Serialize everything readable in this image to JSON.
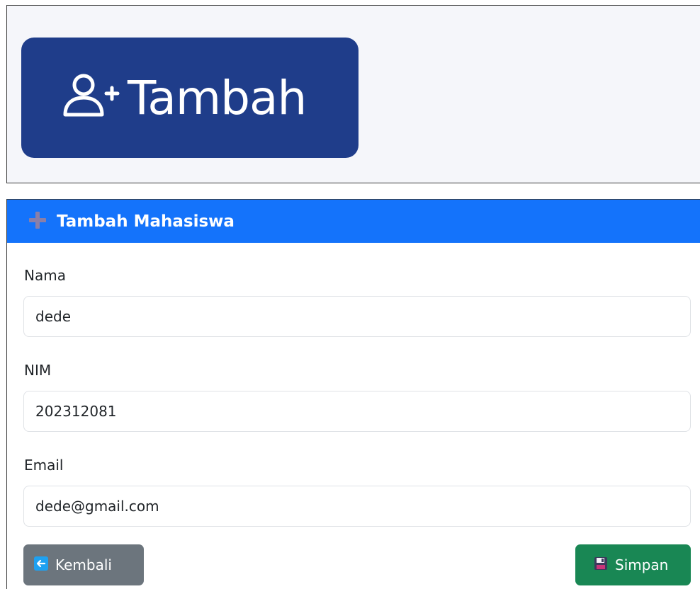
{
  "top_button": {
    "label": "Tambah",
    "icon": "user-plus-icon",
    "bg_color": "#1f3d8a"
  },
  "form_card": {
    "title": "Tambah Mahasiswa",
    "header_icon": "plus-icon",
    "header_color": "#1473fb",
    "fields": [
      {
        "label": "Nama",
        "value": "dede"
      },
      {
        "label": "NIM",
        "value": "202312081"
      },
      {
        "label": "Email",
        "value": "dede@gmail.com"
      }
    ],
    "back_button": {
      "label": "Kembali",
      "icon": "arrow-left-icon",
      "color": "#6c757d"
    },
    "save_button": {
      "label": "Simpan",
      "icon": "floppy-disk-icon",
      "color": "#198754"
    }
  }
}
